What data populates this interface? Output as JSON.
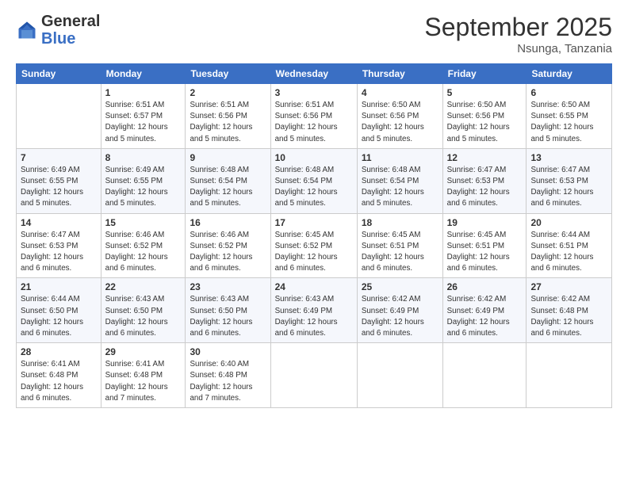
{
  "logo": {
    "general": "General",
    "blue": "Blue"
  },
  "header": {
    "month": "September 2025",
    "location": "Nsunga, Tanzania"
  },
  "weekdays": [
    "Sunday",
    "Monday",
    "Tuesday",
    "Wednesday",
    "Thursday",
    "Friday",
    "Saturday"
  ],
  "weeks": [
    [
      {
        "day": "",
        "info": ""
      },
      {
        "day": "1",
        "info": "Sunrise: 6:51 AM\nSunset: 6:57 PM\nDaylight: 12 hours\nand 5 minutes."
      },
      {
        "day": "2",
        "info": "Sunrise: 6:51 AM\nSunset: 6:56 PM\nDaylight: 12 hours\nand 5 minutes."
      },
      {
        "day": "3",
        "info": "Sunrise: 6:51 AM\nSunset: 6:56 PM\nDaylight: 12 hours\nand 5 minutes."
      },
      {
        "day": "4",
        "info": "Sunrise: 6:50 AM\nSunset: 6:56 PM\nDaylight: 12 hours\nand 5 minutes."
      },
      {
        "day": "5",
        "info": "Sunrise: 6:50 AM\nSunset: 6:56 PM\nDaylight: 12 hours\nand 5 minutes."
      },
      {
        "day": "6",
        "info": "Sunrise: 6:50 AM\nSunset: 6:55 PM\nDaylight: 12 hours\nand 5 minutes."
      }
    ],
    [
      {
        "day": "7",
        "info": "Sunrise: 6:49 AM\nSunset: 6:55 PM\nDaylight: 12 hours\nand 5 minutes."
      },
      {
        "day": "8",
        "info": "Sunrise: 6:49 AM\nSunset: 6:55 PM\nDaylight: 12 hours\nand 5 minutes."
      },
      {
        "day": "9",
        "info": "Sunrise: 6:48 AM\nSunset: 6:54 PM\nDaylight: 12 hours\nand 5 minutes."
      },
      {
        "day": "10",
        "info": "Sunrise: 6:48 AM\nSunset: 6:54 PM\nDaylight: 12 hours\nand 5 minutes."
      },
      {
        "day": "11",
        "info": "Sunrise: 6:48 AM\nSunset: 6:54 PM\nDaylight: 12 hours\nand 5 minutes."
      },
      {
        "day": "12",
        "info": "Sunrise: 6:47 AM\nSunset: 6:53 PM\nDaylight: 12 hours\nand 6 minutes."
      },
      {
        "day": "13",
        "info": "Sunrise: 6:47 AM\nSunset: 6:53 PM\nDaylight: 12 hours\nand 6 minutes."
      }
    ],
    [
      {
        "day": "14",
        "info": "Sunrise: 6:47 AM\nSunset: 6:53 PM\nDaylight: 12 hours\nand 6 minutes."
      },
      {
        "day": "15",
        "info": "Sunrise: 6:46 AM\nSunset: 6:52 PM\nDaylight: 12 hours\nand 6 minutes."
      },
      {
        "day": "16",
        "info": "Sunrise: 6:46 AM\nSunset: 6:52 PM\nDaylight: 12 hours\nand 6 minutes."
      },
      {
        "day": "17",
        "info": "Sunrise: 6:45 AM\nSunset: 6:52 PM\nDaylight: 12 hours\nand 6 minutes."
      },
      {
        "day": "18",
        "info": "Sunrise: 6:45 AM\nSunset: 6:51 PM\nDaylight: 12 hours\nand 6 minutes."
      },
      {
        "day": "19",
        "info": "Sunrise: 6:45 AM\nSunset: 6:51 PM\nDaylight: 12 hours\nand 6 minutes."
      },
      {
        "day": "20",
        "info": "Sunrise: 6:44 AM\nSunset: 6:51 PM\nDaylight: 12 hours\nand 6 minutes."
      }
    ],
    [
      {
        "day": "21",
        "info": "Sunrise: 6:44 AM\nSunset: 6:50 PM\nDaylight: 12 hours\nand 6 minutes."
      },
      {
        "day": "22",
        "info": "Sunrise: 6:43 AM\nSunset: 6:50 PM\nDaylight: 12 hours\nand 6 minutes."
      },
      {
        "day": "23",
        "info": "Sunrise: 6:43 AM\nSunset: 6:50 PM\nDaylight: 12 hours\nand 6 minutes."
      },
      {
        "day": "24",
        "info": "Sunrise: 6:43 AM\nSunset: 6:49 PM\nDaylight: 12 hours\nand 6 minutes."
      },
      {
        "day": "25",
        "info": "Sunrise: 6:42 AM\nSunset: 6:49 PM\nDaylight: 12 hours\nand 6 minutes."
      },
      {
        "day": "26",
        "info": "Sunrise: 6:42 AM\nSunset: 6:49 PM\nDaylight: 12 hours\nand 6 minutes."
      },
      {
        "day": "27",
        "info": "Sunrise: 6:42 AM\nSunset: 6:48 PM\nDaylight: 12 hours\nand 6 minutes."
      }
    ],
    [
      {
        "day": "28",
        "info": "Sunrise: 6:41 AM\nSunset: 6:48 PM\nDaylight: 12 hours\nand 6 minutes."
      },
      {
        "day": "29",
        "info": "Sunrise: 6:41 AM\nSunset: 6:48 PM\nDaylight: 12 hours\nand 7 minutes."
      },
      {
        "day": "30",
        "info": "Sunrise: 6:40 AM\nSunset: 6:48 PM\nDaylight: 12 hours\nand 7 minutes."
      },
      {
        "day": "",
        "info": ""
      },
      {
        "day": "",
        "info": ""
      },
      {
        "day": "",
        "info": ""
      },
      {
        "day": "",
        "info": ""
      }
    ]
  ]
}
